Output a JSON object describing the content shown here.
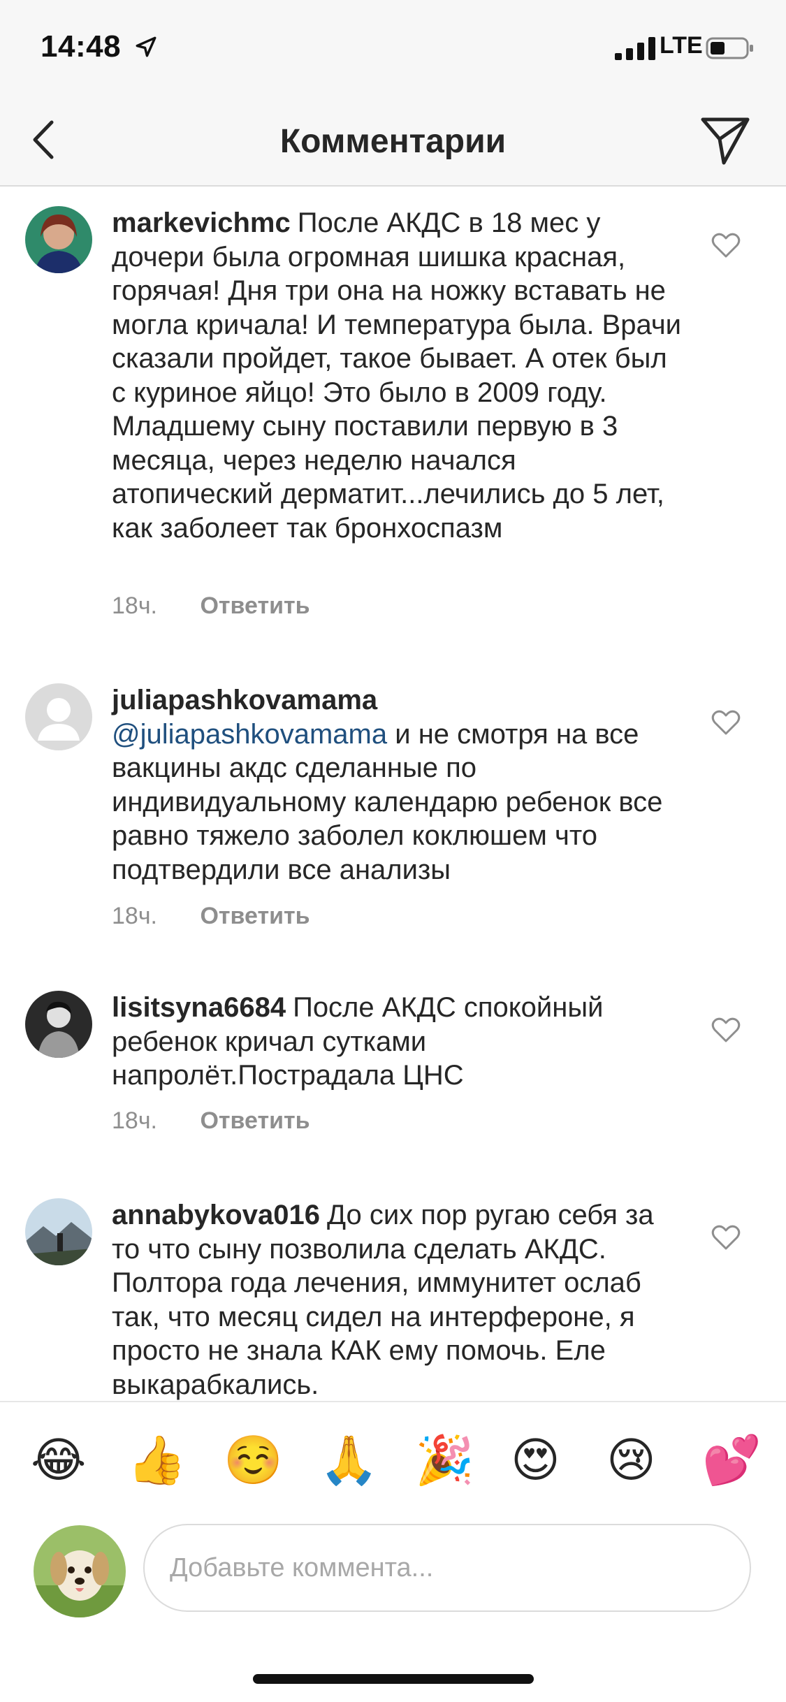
{
  "status_bar": {
    "time": "14:48",
    "network": "LTE"
  },
  "header": {
    "title": "Комментарии"
  },
  "comments": [
    {
      "username": "markevichmc",
      "mention": "",
      "text": "После АКДС в 18 мес у дочери была огромная шишка красная, горячая! Дня три она на ножку вставать не могла кричала! И температура была. Врачи сказали пройдет, такое бывает. А отек был с куриное яйцо! Это было в 2009 году. Младшему сыну поставили первую в 3 месяца, через неделю начался атопический дерматит...лечились до 5 лет, как заболеет так бронхоспазм",
      "time": "18ч.",
      "reply": "Ответить"
    },
    {
      "username": "juliapashkovamama",
      "mention": "@juliapashkovamama",
      "text": "и не смотря на все вакцины акдс сделанные по индивидуальному календарю ребенок все равно тяжело заболел коклюшем что подтвердили все анализы",
      "time": "18ч.",
      "reply": "Ответить"
    },
    {
      "username": "lisitsyna6684",
      "mention": "",
      "text": "После АКДС спокойный ребенок кричал сутками напролёт.Пострадала ЦНС",
      "time": "18ч.",
      "reply": "Ответить"
    },
    {
      "username": "annabykova016",
      "mention": "",
      "text": "До сих пор ругаю себя за то что сыну позволила сделать АКДС. Полтора года лечения, иммунитет ослаб так, что месяц сидел на интерфероне, я просто не знала КАК ему помочь. Еле выкарабкались.",
      "time": "",
      "reply": ""
    }
  ],
  "emoji_bar": [
    "😂",
    "👍",
    "☺️",
    "🙏",
    "🎉",
    "😍",
    "😢",
    "💕"
  ],
  "compose": {
    "placeholder": "Добавьте коммента..."
  }
}
